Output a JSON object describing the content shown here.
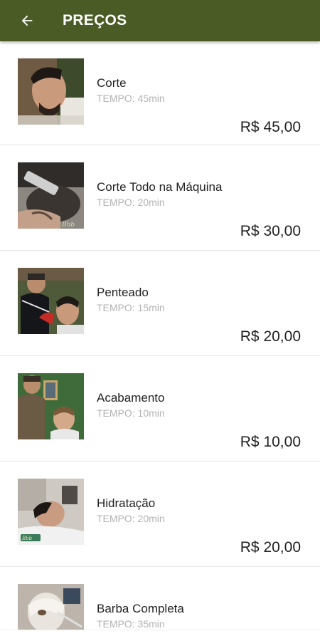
{
  "header": {
    "title": "PREÇOS",
    "back_icon": "arrow-left-icon",
    "background": "#4a5b26"
  },
  "services": [
    {
      "name": "Corte",
      "time": "TEMPO: 45min",
      "price": "R$ 45,00"
    },
    {
      "name": "Corte Todo na Máquina",
      "time": "TEMPO: 20min",
      "price": "R$ 30,00"
    },
    {
      "name": "Penteado",
      "time": "TEMPO: 15min",
      "price": "R$ 20,00"
    },
    {
      "name": "Acabamento",
      "time": "TEMPO: 10min",
      "price": "R$ 10,00"
    },
    {
      "name": "Hidratação",
      "time": "TEMPO: 20min",
      "price": "R$ 20,00"
    },
    {
      "name": "Barba Completa",
      "time": "TEMPO: 35min",
      "price": ""
    }
  ]
}
